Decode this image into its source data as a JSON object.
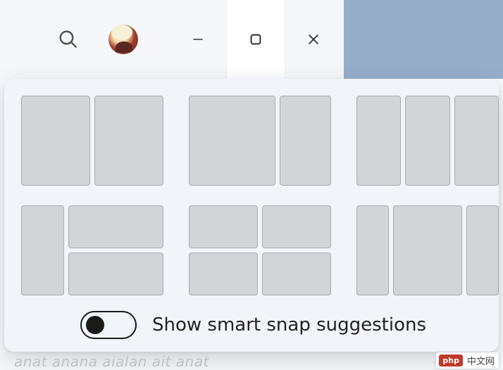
{
  "window_controls": {
    "minimize": "minimize",
    "maximize": "maximize",
    "close": "close"
  },
  "avatar": {
    "alt": "user-avatar"
  },
  "snap_layouts": {
    "layouts": [
      {
        "id": "two-col-even",
        "zone_count": 2
      },
      {
        "id": "two-col-wide-left",
        "zone_count": 2
      },
      {
        "id": "three-col-even",
        "zone_count": 3
      },
      {
        "id": "left-col-right-stack",
        "zone_count": 3
      },
      {
        "id": "four-quad",
        "zone_count": 4
      },
      {
        "id": "three-col-wide-center",
        "zone_count": 3
      }
    ],
    "toggle": {
      "label": "Show smart snap suggestions",
      "state": false
    }
  },
  "watermark": {
    "badge": "php",
    "text": "中文网"
  },
  "ghost_text": "anat anana aialan ait anat"
}
